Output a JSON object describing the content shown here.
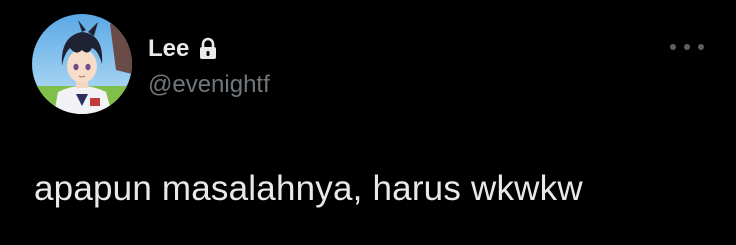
{
  "user": {
    "display_name": "Lee",
    "handle": "@evenightf",
    "protected_icon": "lock-icon",
    "avatar": "avatar-anime-character"
  },
  "tweet": {
    "text": "apapun masalahnya, harus wkwkw"
  },
  "actions": {
    "more_icon": "more-horizontal-icon"
  },
  "colors": {
    "background": "#000000",
    "primary_text": "#e7e9ea",
    "secondary_text": "#71767b",
    "icon_muted": "#5b6066"
  }
}
